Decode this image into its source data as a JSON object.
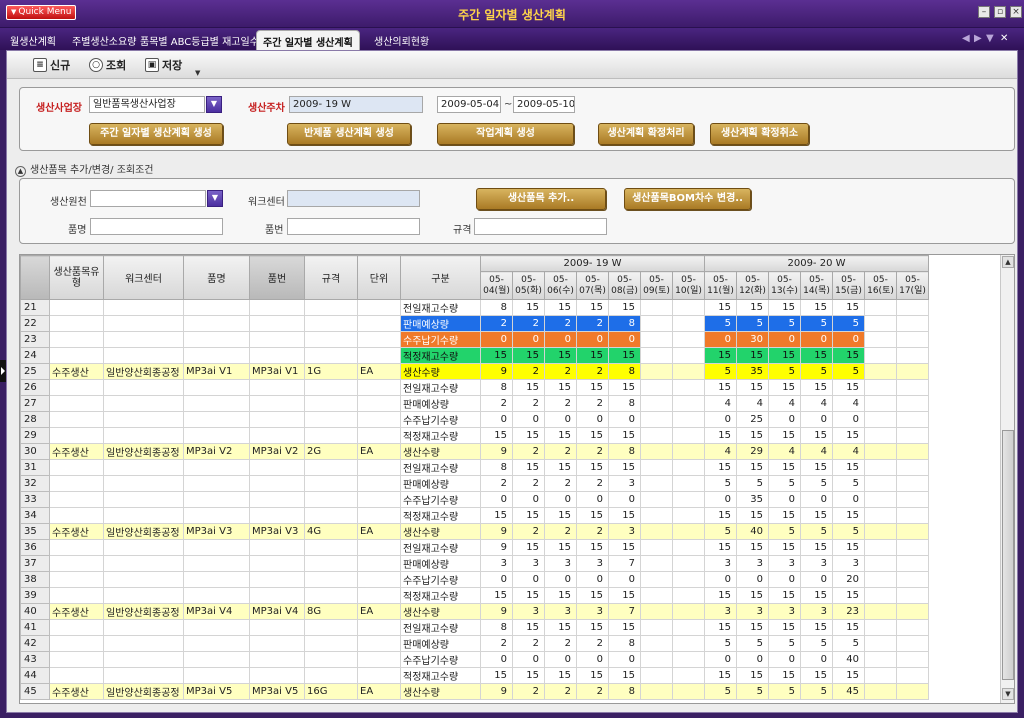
{
  "window": {
    "title": "주간 일자별 생산계획",
    "quick_menu": "Quick Menu"
  },
  "tabs": [
    "월생산계획",
    "주별생산소요량",
    "품목별 ABC등급별 재고일수",
    "주간 일자별 생산계획",
    "생산의뢰현황"
  ],
  "toolbar": {
    "new_label": "신규",
    "search_label": "조회",
    "save_label": "저장"
  },
  "form": {
    "plant_label": "생산사업장",
    "plant_value": "일반품목생산사업장",
    "week_label": "생산주차",
    "week_value": "2009- 19 W",
    "date_from": "2009-05-04",
    "tilde": "~",
    "date_to": "2009-05-10",
    "btn_create": "주간 일자별 생산계획 생성",
    "btn_semi": "반제품 생산계획 생성",
    "btn_work": "작업계획 생성",
    "btn_confirm": "생산계획 확정처리",
    "btn_cancel": "생산계획 확정취소"
  },
  "section_title": "생산품목 추가/변경/ 조회조건",
  "conditions": {
    "source_label": "생산원천",
    "workcenter_label": "워크센터",
    "itemname_label": "품명",
    "itemno_label": "품번",
    "spec_label": "규격",
    "btn_add": "생산품목 추가..",
    "btn_bom": "생산품목BOM차수 변경.."
  },
  "grid": {
    "headers": {
      "type": "생산품목유형",
      "workcenter": "워크센터",
      "itemname": "품명",
      "itemno": "품번",
      "spec": "규격",
      "unit": "단위",
      "category": "구분",
      "week1": "2009- 19 W",
      "week2": "2009- 20 W"
    },
    "days": [
      "05-04(월)",
      "05-05(화)",
      "05-06(수)",
      "05-07(목)",
      "05-08(금)",
      "05-09(토)",
      "05-10(일)",
      "05-11(월)",
      "05-12(화)",
      "05-13(수)",
      "05-14(목)",
      "05-15(금)",
      "05-16(토)",
      "05-17(일)"
    ],
    "rows": [
      {
        "n": "21",
        "t": "",
        "w": "",
        "nm": "",
        "no": "",
        "s": "",
        "u": "",
        "c": "전일재고수량",
        "v": [
          "8",
          "15",
          "15",
          "15",
          "15",
          "",
          "",
          "15",
          "15",
          "15",
          "15",
          "15",
          "",
          ""
        ]
      },
      {
        "n": "22",
        "t": "",
        "w": "",
        "nm": "",
        "no": "",
        "s": "",
        "u": "",
        "c": "판매예상량",
        "v": [
          "2",
          "2",
          "2",
          "2",
          "8",
          "",
          "",
          "5",
          "5",
          "5",
          "5",
          "5",
          "",
          ""
        ],
        "hl": "sel-blue"
      },
      {
        "n": "23",
        "t": "",
        "w": "",
        "nm": "",
        "no": "",
        "s": "",
        "u": "",
        "c": "수주납기수량",
        "v": [
          "0",
          "0",
          "0",
          "0",
          "0",
          "",
          "",
          "0",
          "30",
          "0",
          "0",
          "0",
          "",
          ""
        ],
        "hl": "sel-orange"
      },
      {
        "n": "24",
        "t": "",
        "w": "",
        "nm": "",
        "no": "",
        "s": "",
        "u": "",
        "c": "적정재고수량",
        "v": [
          "15",
          "15",
          "15",
          "15",
          "15",
          "",
          "",
          "15",
          "15",
          "15",
          "15",
          "15",
          "",
          ""
        ],
        "hl": "sel-green"
      },
      {
        "n": "25",
        "t": "수주생산",
        "w": "일반양산회종공정",
        "nm": "MP3ai V1",
        "no": "MP3ai V1",
        "s": "1G",
        "u": "EA",
        "c": "생산수량",
        "v": [
          "9",
          "2",
          "2",
          "2",
          "8",
          "",
          "",
          "5",
          "35",
          "5",
          "5",
          "5",
          "",
          ""
        ],
        "prod": true,
        "hl": "sel-yellow"
      },
      {
        "n": "26",
        "t": "",
        "w": "",
        "nm": "",
        "no": "",
        "s": "",
        "u": "",
        "c": "전일재고수량",
        "v": [
          "8",
          "15",
          "15",
          "15",
          "15",
          "",
          "",
          "15",
          "15",
          "15",
          "15",
          "15",
          "",
          ""
        ]
      },
      {
        "n": "27",
        "t": "",
        "w": "",
        "nm": "",
        "no": "",
        "s": "",
        "u": "",
        "c": "판매예상량",
        "v": [
          "2",
          "2",
          "2",
          "2",
          "8",
          "",
          "",
          "4",
          "4",
          "4",
          "4",
          "4",
          "",
          ""
        ]
      },
      {
        "n": "28",
        "t": "",
        "w": "",
        "nm": "",
        "no": "",
        "s": "",
        "u": "",
        "c": "수주납기수량",
        "v": [
          "0",
          "0",
          "0",
          "0",
          "0",
          "",
          "",
          "0",
          "25",
          "0",
          "0",
          "0",
          "",
          ""
        ]
      },
      {
        "n": "29",
        "t": "",
        "w": "",
        "nm": "",
        "no": "",
        "s": "",
        "u": "",
        "c": "적정재고수량",
        "v": [
          "15",
          "15",
          "15",
          "15",
          "15",
          "",
          "",
          "15",
          "15",
          "15",
          "15",
          "15",
          "",
          ""
        ]
      },
      {
        "n": "30",
        "t": "수주생산",
        "w": "일반양산회종공정",
        "nm": "MP3ai V2",
        "no": "MP3ai V2",
        "s": "2G",
        "u": "EA",
        "c": "생산수량",
        "v": [
          "9",
          "2",
          "2",
          "2",
          "8",
          "",
          "",
          "4",
          "29",
          "4",
          "4",
          "4",
          "",
          ""
        ],
        "prod": true
      },
      {
        "n": "31",
        "t": "",
        "w": "",
        "nm": "",
        "no": "",
        "s": "",
        "u": "",
        "c": "전일재고수량",
        "v": [
          "8",
          "15",
          "15",
          "15",
          "15",
          "",
          "",
          "15",
          "15",
          "15",
          "15",
          "15",
          "",
          ""
        ]
      },
      {
        "n": "32",
        "t": "",
        "w": "",
        "nm": "",
        "no": "",
        "s": "",
        "u": "",
        "c": "판매예상량",
        "v": [
          "2",
          "2",
          "2",
          "2",
          "3",
          "",
          "",
          "5",
          "5",
          "5",
          "5",
          "5",
          "",
          ""
        ]
      },
      {
        "n": "33",
        "t": "",
        "w": "",
        "nm": "",
        "no": "",
        "s": "",
        "u": "",
        "c": "수주납기수량",
        "v": [
          "0",
          "0",
          "0",
          "0",
          "0",
          "",
          "",
          "0",
          "35",
          "0",
          "0",
          "0",
          "",
          ""
        ]
      },
      {
        "n": "34",
        "t": "",
        "w": "",
        "nm": "",
        "no": "",
        "s": "",
        "u": "",
        "c": "적정재고수량",
        "v": [
          "15",
          "15",
          "15",
          "15",
          "15",
          "",
          "",
          "15",
          "15",
          "15",
          "15",
          "15",
          "",
          ""
        ]
      },
      {
        "n": "35",
        "t": "수주생산",
        "w": "일반양산회종공정",
        "nm": "MP3ai V3",
        "no": "MP3ai V3",
        "s": "4G",
        "u": "EA",
        "c": "생산수량",
        "v": [
          "9",
          "2",
          "2",
          "2",
          "3",
          "",
          "",
          "5",
          "40",
          "5",
          "5",
          "5",
          "",
          ""
        ],
        "prod": true
      },
      {
        "n": "36",
        "t": "",
        "w": "",
        "nm": "",
        "no": "",
        "s": "",
        "u": "",
        "c": "전일재고수량",
        "v": [
          "9",
          "15",
          "15",
          "15",
          "15",
          "",
          "",
          "15",
          "15",
          "15",
          "15",
          "15",
          "",
          ""
        ]
      },
      {
        "n": "37",
        "t": "",
        "w": "",
        "nm": "",
        "no": "",
        "s": "",
        "u": "",
        "c": "판매예상량",
        "v": [
          "3",
          "3",
          "3",
          "3",
          "7",
          "",
          "",
          "3",
          "3",
          "3",
          "3",
          "3",
          "",
          ""
        ]
      },
      {
        "n": "38",
        "t": "",
        "w": "",
        "nm": "",
        "no": "",
        "s": "",
        "u": "",
        "c": "수주납기수량",
        "v": [
          "0",
          "0",
          "0",
          "0",
          "0",
          "",
          "",
          "0",
          "0",
          "0",
          "0",
          "20",
          "",
          ""
        ]
      },
      {
        "n": "39",
        "t": "",
        "w": "",
        "nm": "",
        "no": "",
        "s": "",
        "u": "",
        "c": "적정재고수량",
        "v": [
          "15",
          "15",
          "15",
          "15",
          "15",
          "",
          "",
          "15",
          "15",
          "15",
          "15",
          "15",
          "",
          ""
        ]
      },
      {
        "n": "40",
        "t": "수주생산",
        "w": "일반양산회종공정",
        "nm": "MP3ai V4",
        "no": "MP3ai V4",
        "s": "8G",
        "u": "EA",
        "c": "생산수량",
        "v": [
          "9",
          "3",
          "3",
          "3",
          "7",
          "",
          "",
          "3",
          "3",
          "3",
          "3",
          "23",
          "",
          ""
        ],
        "prod": true
      },
      {
        "n": "41",
        "t": "",
        "w": "",
        "nm": "",
        "no": "",
        "s": "",
        "u": "",
        "c": "전일재고수량",
        "v": [
          "8",
          "15",
          "15",
          "15",
          "15",
          "",
          "",
          "15",
          "15",
          "15",
          "15",
          "15",
          "",
          ""
        ]
      },
      {
        "n": "42",
        "t": "",
        "w": "",
        "nm": "",
        "no": "",
        "s": "",
        "u": "",
        "c": "판매예상량",
        "v": [
          "2",
          "2",
          "2",
          "2",
          "8",
          "",
          "",
          "5",
          "5",
          "5",
          "5",
          "5",
          "",
          ""
        ]
      },
      {
        "n": "43",
        "t": "",
        "w": "",
        "nm": "",
        "no": "",
        "s": "",
        "u": "",
        "c": "수주납기수량",
        "v": [
          "0",
          "0",
          "0",
          "0",
          "0",
          "",
          "",
          "0",
          "0",
          "0",
          "0",
          "40",
          "",
          ""
        ]
      },
      {
        "n": "44",
        "t": "",
        "w": "",
        "nm": "",
        "no": "",
        "s": "",
        "u": "",
        "c": "적정재고수량",
        "v": [
          "15",
          "15",
          "15",
          "15",
          "15",
          "",
          "",
          "15",
          "15",
          "15",
          "15",
          "15",
          "",
          ""
        ]
      },
      {
        "n": "45",
        "t": "수주생산",
        "w": "일반양산회종공정",
        "nm": "MP3ai V5",
        "no": "MP3ai V5",
        "s": "16G",
        "u": "EA",
        "c": "생산수량",
        "v": [
          "9",
          "2",
          "2",
          "2",
          "8",
          "",
          "",
          "5",
          "5",
          "5",
          "5",
          "45",
          "",
          ""
        ],
        "prod": true
      }
    ]
  }
}
